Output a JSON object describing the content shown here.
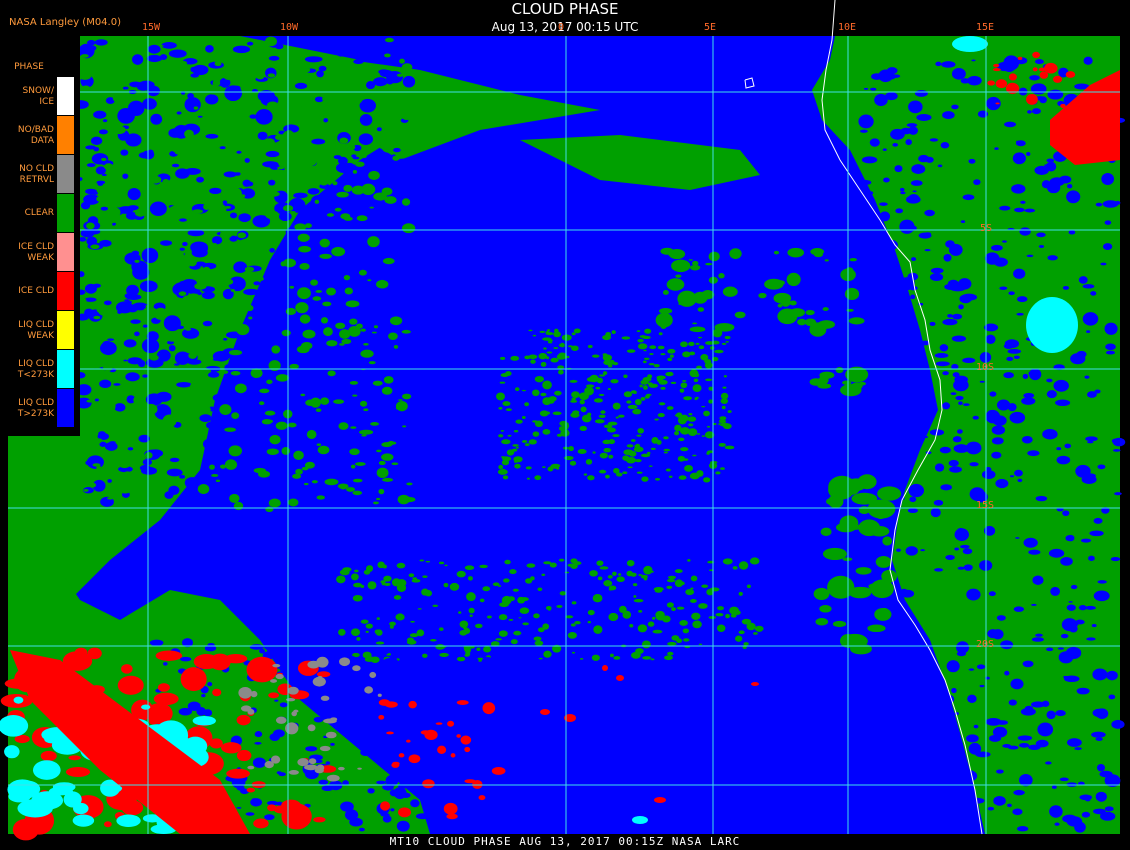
{
  "header": {
    "title": "CLOUD PHASE",
    "datetime": "Aug 13, 2017 00:15 UTC",
    "provider": "NASA Langley (M04.0)"
  },
  "footer": {
    "text": "MT10  CLOUD PHASE  AUG 13, 2017 00:15Z  NASA LARC"
  },
  "legend": {
    "heading": "PHASE",
    "items": [
      {
        "line1": "SNOW/",
        "line2": "ICE",
        "color": "#ffffff"
      },
      {
        "line1": "NO/BAD",
        "line2": "DATA",
        "color": "#ff8000"
      },
      {
        "line1": "NO CLD",
        "line2": "RETRVL",
        "color": "#8a8a8a"
      },
      {
        "line1": "CLEAR",
        "line2": "",
        "color": "#00a000"
      },
      {
        "line1": "ICE CLD",
        "line2": "WEAK",
        "color": "#ff9090"
      },
      {
        "line1": "ICE CLD",
        "line2": "",
        "color": "#ff0000"
      },
      {
        "line1": "LIQ CLD",
        "line2": "WEAK",
        "color": "#ffff00"
      },
      {
        "line1": "LIQ CLD",
        "line2": "T<273K",
        "color": "#00ffff"
      },
      {
        "line1": "LIQ CLD",
        "line2": "T>273K",
        "color": "#0000ff"
      }
    ]
  },
  "graticule": {
    "lon_labels": [
      "15W",
      "10W",
      "0",
      "5E",
      "10E",
      "15E"
    ],
    "lat_labels": [
      "5S",
      "10S",
      "15S",
      "20S"
    ],
    "color": "#40e0e8"
  },
  "colors": {
    "ocean_liquid_cloud": "#0000ff",
    "clear": "#00a000",
    "ice_cloud": "#ff0000",
    "liquid_cold": "#00ffff",
    "no_retrieval": "#8a8a8a",
    "coastline": "#ffffff",
    "label": "#ff6a2a"
  }
}
